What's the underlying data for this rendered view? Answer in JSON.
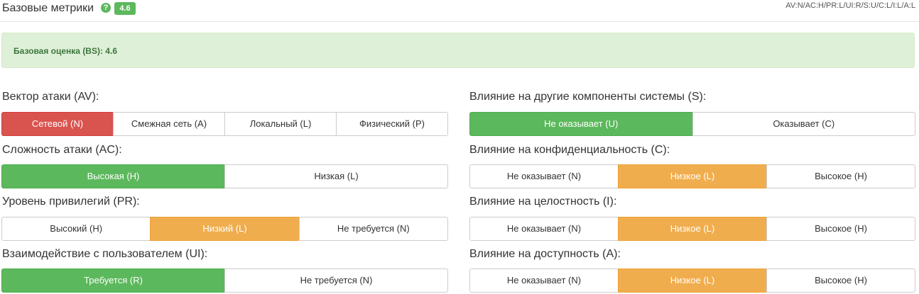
{
  "header": {
    "title": "Базовые метрики",
    "help_icon": "?",
    "score": "4.6",
    "vector": "AV:N/AC:H/PR:L/UI:R/S:U/C:L/I:L/A:L"
  },
  "alert": {
    "text": "Базовая оценка (BS): 4.6"
  },
  "colors": {
    "red": "#d9534f",
    "green": "#5cb85c",
    "orange": "#f0ad4e"
  },
  "metrics": {
    "av": {
      "label": "Вектор атаки (AV):",
      "options": [
        "Сетевой (N)",
        "Смежная сеть (A)",
        "Локальный (L)",
        "Физический (P)"
      ],
      "selected": 0
    },
    "ac": {
      "label": "Сложность атаки (AC):",
      "options": [
        "Высокая (H)",
        "Низкая (L)"
      ],
      "selected": 0
    },
    "pr": {
      "label": "Уровень привилегий (PR):",
      "options": [
        "Высокий (H)",
        "Низкий (L)",
        "Не требуется (N)"
      ],
      "selected": 1
    },
    "ui": {
      "label": "Взаимодействие с пользователем (UI):",
      "options": [
        "Требуется (R)",
        "Не требуется (N)"
      ],
      "selected": 0
    },
    "s": {
      "label": "Влияние на другие компоненты системы (S):",
      "options": [
        "Не оказывает (U)",
        "Оказывает (C)"
      ],
      "selected": 0
    },
    "c": {
      "label": "Влияние на конфиденциальность (C):",
      "options": [
        "Не оказывает (N)",
        "Низкое (L)",
        "Высокое (H)"
      ],
      "selected": 1
    },
    "i": {
      "label": "Влияние на целостность (I):",
      "options": [
        "Не оказывает (N)",
        "Низкое (L)",
        "Высокое (H)"
      ],
      "selected": 1
    },
    "a": {
      "label": "Влияние на доступность (A):",
      "options": [
        "Не оказывает (N)",
        "Низкое (L)",
        "Высокое (H)"
      ],
      "selected": 1
    }
  }
}
